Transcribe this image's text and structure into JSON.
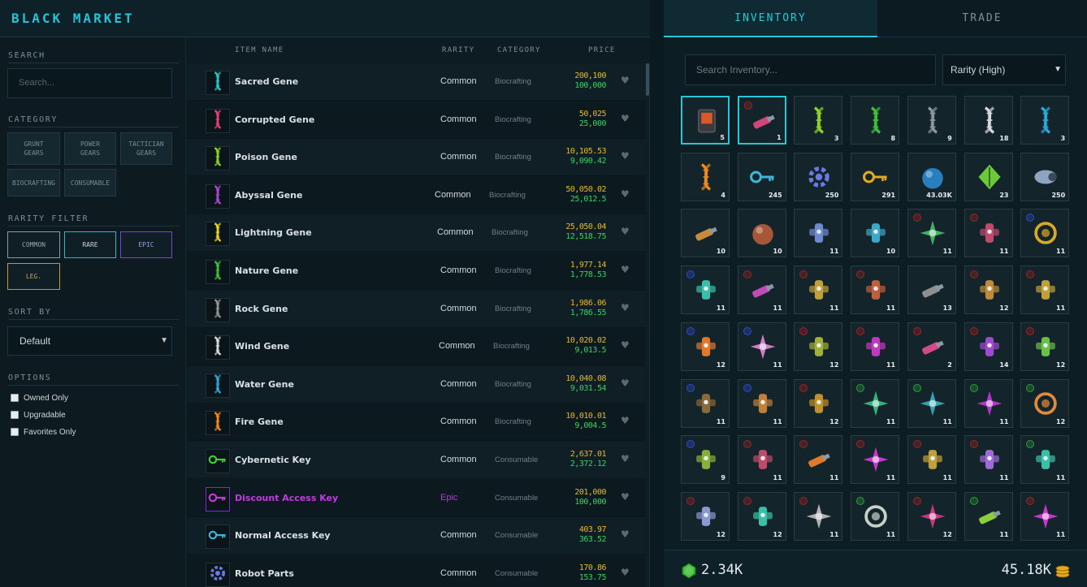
{
  "app_title": "BLACK MARKET",
  "sidebar": {
    "search_label": "SEARCH",
    "search_placeholder": "Search...",
    "category_label": "CATEGORY",
    "categories": [
      "GRUNT\nGEARS",
      "POWER\nGEARS",
      "TACTICIAN\nGEARS",
      "BIOCRAFTING",
      "CONSUMABLE"
    ],
    "rarity_label": "RARITY FILTER",
    "rarities": [
      {
        "label": "COMMON",
        "color": "#8a9aa0"
      },
      {
        "label": "RARE",
        "color": "#2fb6c8"
      },
      {
        "label": "EPIC",
        "color": "#7a42d6"
      },
      {
        "label": "LEG.",
        "color": "#c99a1a"
      }
    ],
    "sort_label": "SORT BY",
    "sort_value": "Default",
    "options_label": "OPTIONS",
    "options": [
      "Owned Only",
      "Upgradable",
      "Favorites Only"
    ]
  },
  "table": {
    "headers": {
      "name": "ITEM NAME",
      "rarity": "RARITY",
      "category": "CATEGORY",
      "price": "PRICE"
    },
    "rows": [
      {
        "name": "Sacred Gene",
        "rarity": "Common",
        "category": "Biocrafting",
        "buy": "200,100",
        "sell": "100,000",
        "icon": "dna-icon",
        "color": "#27c8c8"
      },
      {
        "name": "Corrupted Gene",
        "rarity": "Common",
        "category": "Biocrafting",
        "buy": "50,025",
        "sell": "25,000",
        "icon": "dna-icon",
        "color": "#e0447a"
      },
      {
        "name": "Poison Gene",
        "rarity": "Common",
        "category": "Biocrafting",
        "buy": "10,105.53",
        "sell": "9,090.42",
        "icon": "dna-icon",
        "color": "#8ed12b"
      },
      {
        "name": "Abyssal Gene",
        "rarity": "Common",
        "category": "Biocrafting",
        "buy": "50,050.02",
        "sell": "25,012.5",
        "icon": "dna-icon",
        "color": "#a64ad0"
      },
      {
        "name": "Lightning Gene",
        "rarity": "Common",
        "category": "Biocrafting",
        "buy": "25,050.04",
        "sell": "12,518.75",
        "icon": "dna-icon",
        "color": "#e8d22a"
      },
      {
        "name": "Nature Gene",
        "rarity": "Common",
        "category": "Biocrafting",
        "buy": "1,977.14",
        "sell": "1,778.53",
        "icon": "dna-icon",
        "color": "#3fbf38"
      },
      {
        "name": "Rock Gene",
        "rarity": "Common",
        "category": "Biocrafting",
        "buy": "1,986.06",
        "sell": "1,786.55",
        "icon": "dna-icon",
        "color": "#8d9599"
      },
      {
        "name": "Wind Gene",
        "rarity": "Common",
        "category": "Biocrafting",
        "buy": "10,020.02",
        "sell": "9,013.5",
        "icon": "dna-icon",
        "color": "#d5dadc"
      },
      {
        "name": "Water Gene",
        "rarity": "Common",
        "category": "Biocrafting",
        "buy": "10,040.08",
        "sell": "9,031.54",
        "icon": "dna-icon",
        "color": "#2aa8d8"
      },
      {
        "name": "Fire Gene",
        "rarity": "Common",
        "category": "Biocrafting",
        "buy": "10,010.01",
        "sell": "9,004.5",
        "icon": "dna-icon",
        "color": "#f08a1c"
      },
      {
        "name": "Cybernetic Key",
        "rarity": "Common",
        "category": "Consumable",
        "buy": "2,637.01",
        "sell": "2,372.12",
        "icon": "key-icon",
        "color": "#3fcf3a"
      },
      {
        "name": "Discount Access Key",
        "rarity": "Epic",
        "category": "Consumable",
        "buy": "201,000",
        "sell": "100,000",
        "icon": "key-icon",
        "color": "#c63bd6"
      },
      {
        "name": "Normal Access Key",
        "rarity": "Common",
        "category": "Consumable",
        "buy": "403.97",
        "sell": "363.52",
        "icon": "key-icon",
        "color": "#3bb6d8"
      },
      {
        "name": "Robot Parts",
        "rarity": "Common",
        "category": "Consumable",
        "buy": "170.86",
        "sell": "153.75",
        "icon": "gear-icon",
        "color": "#6b7ae0"
      }
    ]
  },
  "inventory": {
    "tabs": [
      "INVENTORY",
      "TRADE"
    ],
    "search_placeholder": "Search Inventory...",
    "rarity_sort": "Rarity (High)",
    "items": [
      {
        "count": "5",
        "icon": "device-icon",
        "color": "#d85a2a",
        "dot": ""
      },
      {
        "count": "1",
        "icon": "gun-icon",
        "color": "#d0467a",
        "dot": "#a02020"
      },
      {
        "count": "3",
        "icon": "dna-icon",
        "color": "#8ed12b",
        "dot": ""
      },
      {
        "count": "8",
        "icon": "dna-icon",
        "color": "#3fbf38",
        "dot": ""
      },
      {
        "count": "9",
        "icon": "dna-icon",
        "color": "#8d9599",
        "dot": ""
      },
      {
        "count": "18",
        "icon": "dna-icon",
        "color": "#d5dadc",
        "dot": ""
      },
      {
        "count": "3",
        "icon": "dna-icon",
        "color": "#2aa8d8",
        "dot": ""
      },
      {
        "count": "4",
        "icon": "dna-icon",
        "color": "#f08a1c",
        "dot": ""
      },
      {
        "count": "245",
        "icon": "key-icon",
        "color": "#3bb6d8",
        "dot": ""
      },
      {
        "count": "250",
        "icon": "gear-icon",
        "color": "#6b7ae0",
        "dot": ""
      },
      {
        "count": "291",
        "icon": "key-icon",
        "color": "#e3a920",
        "dot": ""
      },
      {
        "count": "43.03K",
        "icon": "orb-icon",
        "color": "#2a8fd8",
        "dot": ""
      },
      {
        "count": "23",
        "icon": "leaf-icon",
        "color": "#6cc93a",
        "dot": ""
      },
      {
        "count": "250",
        "icon": "engine-icon",
        "color": "#8fa4c0",
        "dot": ""
      },
      {
        "count": "10",
        "icon": "gun-icon",
        "color": "#c98a3a",
        "dot": ""
      },
      {
        "count": "10",
        "icon": "orb-icon",
        "color": "#c0603a",
        "dot": ""
      },
      {
        "count": "11",
        "icon": "mech-icon",
        "color": "#6f8ad0",
        "dot": ""
      },
      {
        "count": "10",
        "icon": "mech-icon",
        "color": "#3aa8c8",
        "dot": ""
      },
      {
        "count": "11",
        "icon": "star-icon",
        "color": "#4ac06a",
        "dot": "#a02020"
      },
      {
        "count": "11",
        "icon": "mech-icon",
        "color": "#c04a6a",
        "dot": "#a02020"
      },
      {
        "count": "11",
        "icon": "ring-icon",
        "color": "#d8a82a",
        "dot": "#2a4ad0"
      },
      {
        "count": "11",
        "icon": "mech-icon",
        "color": "#3ac0a8",
        "dot": "#2a4ad0"
      },
      {
        "count": "11",
        "icon": "gun-icon",
        "color": "#c04ab8",
        "dot": "#a02020"
      },
      {
        "count": "11",
        "icon": "mech-icon",
        "color": "#c0a03a",
        "dot": "#a02020"
      },
      {
        "count": "11",
        "icon": "mech-icon",
        "color": "#c0603a",
        "dot": "#a02020"
      },
      {
        "count": "13",
        "icon": "gun-icon",
        "color": "#8f8f8f",
        "dot": ""
      },
      {
        "count": "12",
        "icon": "mech-icon",
        "color": "#c08a3a",
        "dot": "#a02020"
      },
      {
        "count": "11",
        "icon": "mech-icon",
        "color": "#c0a03a",
        "dot": "#a02020"
      },
      {
        "count": "12",
        "icon": "mech-icon",
        "color": "#e07a2a",
        "dot": "#2a4ad0"
      },
      {
        "count": "11",
        "icon": "star-icon",
        "color": "#e08ad8",
        "dot": "#2a4ad0"
      },
      {
        "count": "12",
        "icon": "mech-icon",
        "color": "#a0b03a",
        "dot": "#a02020"
      },
      {
        "count": "11",
        "icon": "mech-icon",
        "color": "#c03ac0",
        "dot": "#a02020"
      },
      {
        "count": "2",
        "icon": "gun-icon",
        "color": "#d04a8a",
        "dot": "#a02020"
      },
      {
        "count": "14",
        "icon": "mech-icon",
        "color": "#a04ad0",
        "dot": "#a02020"
      },
      {
        "count": "12",
        "icon": "mech-icon",
        "color": "#6ac04a",
        "dot": "#a02020"
      },
      {
        "count": "11",
        "icon": "mech-icon",
        "color": "#8a6a3a",
        "dot": "#2a4ad0"
      },
      {
        "count": "11",
        "icon": "mech-icon",
        "color": "#c0803a",
        "dot": "#2a4ad0"
      },
      {
        "count": "12",
        "icon": "mech-icon",
        "color": "#c0902a",
        "dot": "#a02020"
      },
      {
        "count": "11",
        "icon": "star-icon",
        "color": "#3ac088",
        "dot": "#2a9a3a"
      },
      {
        "count": "11",
        "icon": "star-icon",
        "color": "#3ab0c0",
        "dot": "#2a9a3a"
      },
      {
        "count": "11",
        "icon": "star-icon",
        "color": "#c03ad8",
        "dot": "#2a9a3a"
      },
      {
        "count": "12",
        "icon": "ring-icon",
        "color": "#e08a3a",
        "dot": "#2a9a3a"
      },
      {
        "count": "9",
        "icon": "mech-icon",
        "color": "#8ab03a",
        "dot": "#2a4ad0"
      },
      {
        "count": "11",
        "icon": "mech-icon",
        "color": "#c04a6a",
        "dot": "#a02020"
      },
      {
        "count": "11",
        "icon": "gun-icon",
        "color": "#e07a2a",
        "dot": "#a02020"
      },
      {
        "count": "11",
        "icon": "star-icon",
        "color": "#d83ad8",
        "dot": "#a02020"
      },
      {
        "count": "11",
        "icon": "mech-icon",
        "color": "#c0a03a",
        "dot": "#a02020"
      },
      {
        "count": "11",
        "icon": "mech-icon",
        "color": "#a06ad8",
        "dot": "#a02020"
      },
      {
        "count": "11",
        "icon": "mech-icon",
        "color": "#3ac0a8",
        "dot": "#2a9a3a"
      },
      {
        "count": "12",
        "icon": "mech-icon",
        "color": "#8a9ad0",
        "dot": "#a02020"
      },
      {
        "count": "12",
        "icon": "mech-icon",
        "color": "#3ac0a8",
        "dot": "#a02020"
      },
      {
        "count": "11",
        "icon": "star-icon",
        "color": "#c0c0c0",
        "dot": "#a02020"
      },
      {
        "count": "11",
        "icon": "ring-icon",
        "color": "#c8d0c8",
        "dot": "#2a9a3a"
      },
      {
        "count": "12",
        "icon": "star-icon",
        "color": "#d83a8a",
        "dot": "#a02020"
      },
      {
        "count": "11",
        "icon": "gun-icon",
        "color": "#8ad03a",
        "dot": "#2a9a3a"
      },
      {
        "count": "11",
        "icon": "star-icon",
        "color": "#d83ad8",
        "dot": "#a02020"
      }
    ]
  },
  "currency": {
    "gems": "2.34K",
    "coins": "45.18K",
    "gem_color": "#3fbf38",
    "coin_color": "#e3a920"
  }
}
